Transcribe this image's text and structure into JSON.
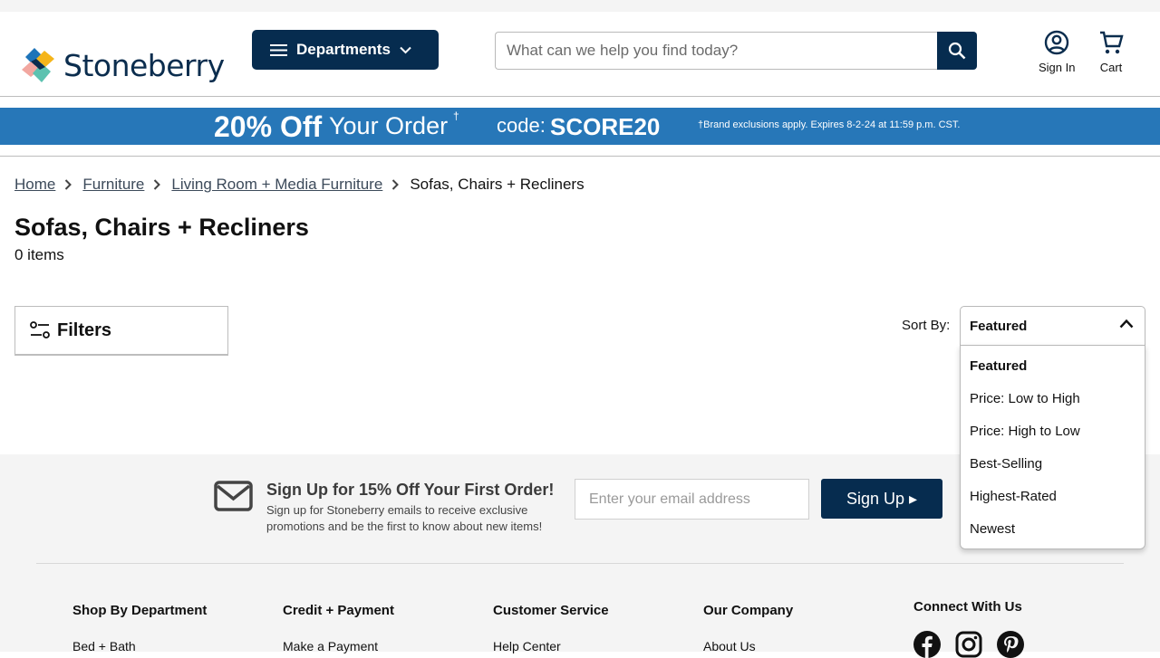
{
  "header": {
    "logo_text": "Stoneberry",
    "departments_label": "Departments",
    "search_placeholder": "What can we help you find today?",
    "sign_in_label": "Sign In",
    "cart_label": "Cart"
  },
  "promo": {
    "headline": "20% Off",
    "headline_suffix": "Your Order",
    "dagger": "†",
    "code_label": "code:",
    "code": "SCORE20",
    "fine_print": "†Brand exclusions apply. Expires 8-2-24 at 11:59 p.m. CST."
  },
  "breadcrumb": {
    "items": [
      "Home",
      "Furniture",
      "Living Room + Media Furniture"
    ],
    "current": "Sofas, Chairs + Recliners"
  },
  "page": {
    "title": "Sofas, Chairs + Recliners",
    "item_count": "0 items"
  },
  "filters": {
    "label": "Filters"
  },
  "sort": {
    "label": "Sort By:",
    "selected": "Featured",
    "options": [
      "Featured",
      "Price: Low to High",
      "Price: High to Low",
      "Best-Selling",
      "Highest-Rated",
      "Newest"
    ]
  },
  "signup": {
    "title": "Sign Up for 15% Off Your First Order!",
    "description": "Sign up for Stoneberry emails to receive exclusive promotions and be the first to know about new items!",
    "email_placeholder": "Enter your email address",
    "button_label": "Sign Up ▸"
  },
  "footer": {
    "columns": [
      {
        "heading": "Shop By Department",
        "first_link": "Bed + Bath"
      },
      {
        "heading": "Credit + Payment",
        "first_link": "Make a Payment"
      },
      {
        "heading": "Customer Service",
        "first_link": "Help Center"
      },
      {
        "heading": "Our Company",
        "first_link": "About Us"
      }
    ],
    "connect_heading": "Connect With Us",
    "social_icons": [
      "facebook-icon",
      "instagram-icon",
      "pinterest-icon"
    ]
  },
  "colors": {
    "navy": "#062c4f",
    "promo_blue": "#2777b8",
    "footer_bg": "#f4f4f4"
  }
}
